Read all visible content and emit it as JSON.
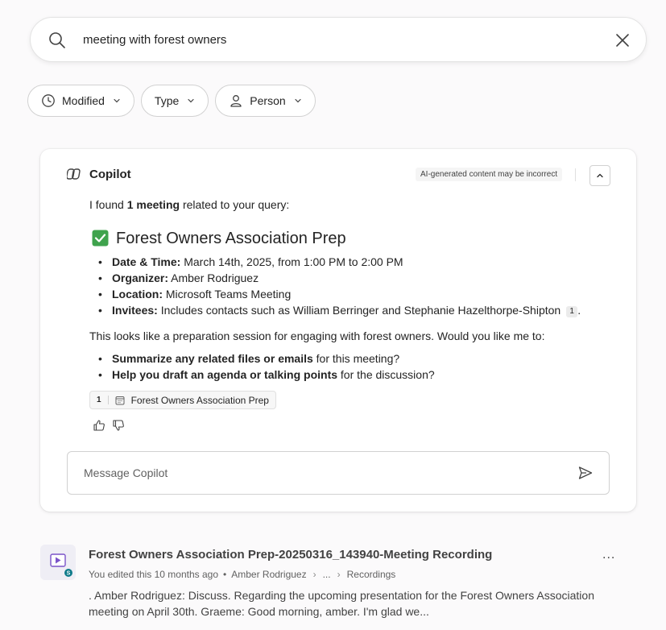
{
  "search": {
    "query": "meeting with forest owners"
  },
  "filters": [
    {
      "label": "Modified",
      "icon": "clock-icon"
    },
    {
      "label": "Type",
      "icon": ""
    },
    {
      "label": "Person",
      "icon": "person-icon"
    }
  ],
  "copilot": {
    "title": "Copilot",
    "ai_notice": "AI-generated content may be incorrect",
    "intro_prefix": "I found ",
    "intro_bold": "1 meeting",
    "intro_suffix": " related to your query:",
    "meeting_title": "Forest Owners Association Prep",
    "details": [
      {
        "label": "Date & Time:",
        "value": " March 14th, 2025, from 1:00 PM to 2:00 PM"
      },
      {
        "label": "Organizer:",
        "value": " Amber Rodriguez"
      },
      {
        "label": "Location:",
        "value": " Microsoft Teams Meeting"
      },
      {
        "label": "Invitees:",
        "value": " Includes contacts such as William Berringer and Stephanie Hazelthorpe-Shipton",
        "cite": "1",
        "trail": "."
      }
    ],
    "paragraph": "This looks like a preparation session for engaging with forest owners. Would you like me to:",
    "suggestions": [
      {
        "bold": "Summarize any related files or emails",
        "rest": " for this meeting?"
      },
      {
        "bold": "Help you draft an agenda or talking points",
        "rest": " for the discussion?"
      }
    ],
    "reference": {
      "num": "1",
      "label": "Forest Owners Association Prep"
    },
    "message_placeholder": "Message Copilot"
  },
  "result": {
    "title": "Forest Owners Association Prep-20250316_143940-Meeting Recording",
    "more": "...",
    "edited": "You edited this 10 months ago",
    "person": "Amber Rodriguez",
    "path_ellipsis": "...",
    "folder": "Recordings",
    "snippet": ". Amber Rodriguez: Discuss. Regarding the upcoming presentation for the Forest Owners Association meeting on April 30th. Graeme: Good morning, amber. I'm glad we..."
  },
  "colors": {
    "accent": "#5b5fc7",
    "check_green": "#3fa34d"
  }
}
